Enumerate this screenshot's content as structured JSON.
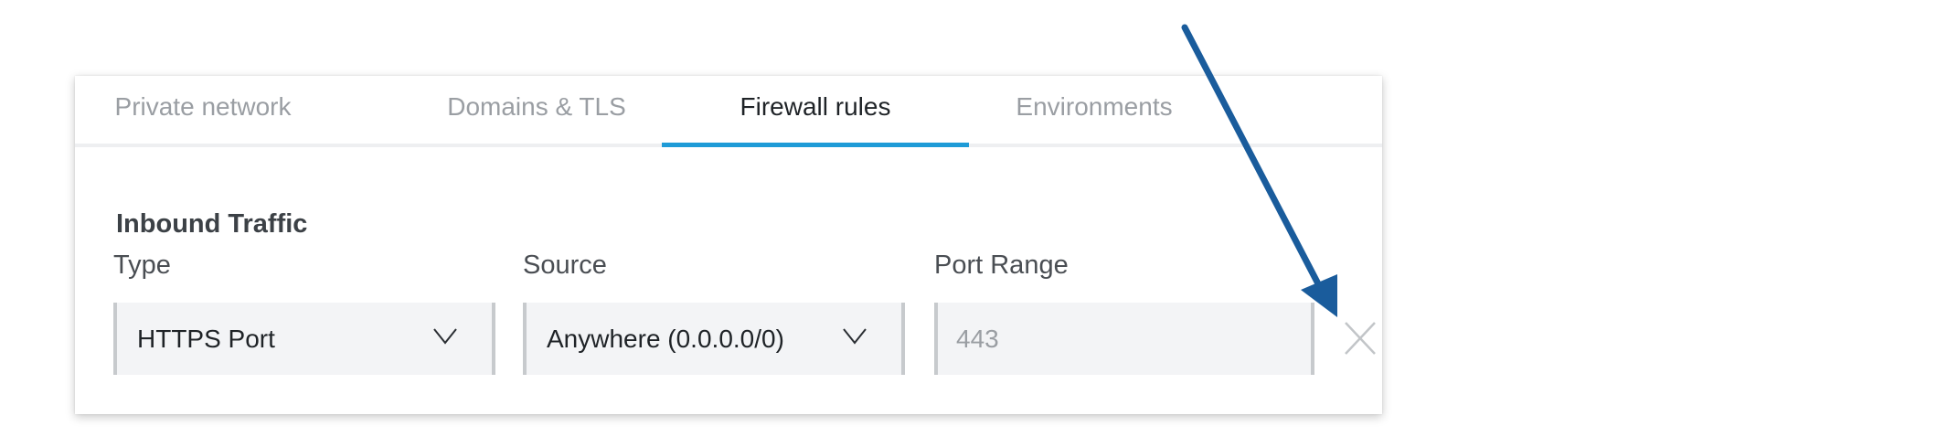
{
  "tabs": [
    {
      "label": "Private network",
      "active": false
    },
    {
      "label": "Domains & TLS",
      "active": false
    },
    {
      "label": "Firewall rules",
      "active": true
    },
    {
      "label": "Environments",
      "active": false
    }
  ],
  "inbound": {
    "title": "Inbound Traffic",
    "type_label": "Type",
    "source_label": "Source",
    "port_label": "Port Range",
    "type_value": "HTTPS Port",
    "source_value": "Anywhere (0.0.0.0/0)",
    "port_value": "443"
  },
  "icons": {
    "dropdown": "chevron-down-icon",
    "remove": "close-icon",
    "annotation": "arrow-annotation"
  },
  "colors": {
    "active_tab_underline": "#1e9bd7",
    "arrow": "#1a5c9c"
  }
}
